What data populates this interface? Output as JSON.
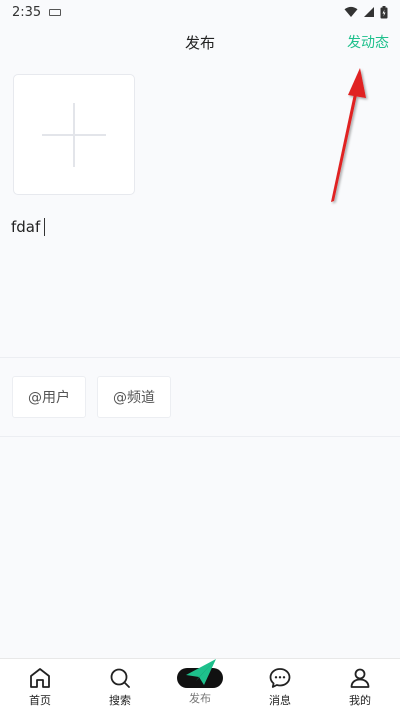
{
  "status_bar": {
    "time": "2:35"
  },
  "header": {
    "title": "发布",
    "action_label": "发动态"
  },
  "editor": {
    "text": "fdaf"
  },
  "tags": {
    "user_label": "@用户",
    "channel_label": "@频道"
  },
  "tabbar": {
    "items": [
      {
        "label": "首页",
        "icon": "home-icon"
      },
      {
        "label": "搜索",
        "icon": "search-icon"
      },
      {
        "label": "发布",
        "icon": "send-icon"
      },
      {
        "label": "消息",
        "icon": "message-icon"
      },
      {
        "label": "我的",
        "icon": "user-icon"
      }
    ]
  },
  "colors": {
    "accent": "#1ec08c",
    "annotation": "#e02020",
    "background": "#f9fafc"
  }
}
